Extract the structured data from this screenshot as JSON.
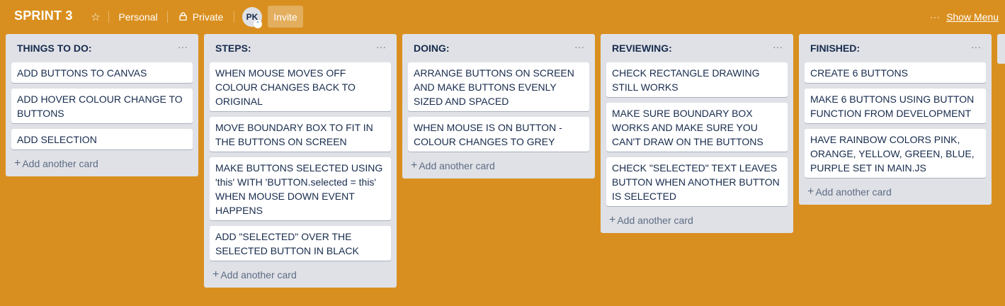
{
  "header": {
    "title": "SPRINT 3",
    "star_icon": "star-icon",
    "personal_label": "Personal",
    "private_label": "Private",
    "lock_icon": "lock-icon",
    "avatar_initials": "PK",
    "invite_label": "Invite",
    "menu_dots": "···",
    "show_menu_label": "Show Menu"
  },
  "add_card_label": "Add another card",
  "colors": {
    "board_background": "#d98f1f",
    "list_background": "#dfe1e6",
    "card_text": "#172b4d"
  },
  "lists": [
    {
      "title": "THINGS TO DO:",
      "cards": [
        "ADD BUTTONS TO CANVAS",
        "ADD HOVER COLOUR CHANGE TO BUTTONS",
        "ADD SELECTION"
      ]
    },
    {
      "title": "STEPS:",
      "cards": [
        "WHEN MOUSE MOVES OFF COLOUR CHANGES BACK TO ORIGINAL",
        "MOVE BOUNDARY BOX TO FIT IN THE BUTTONS ON SCREEN",
        "MAKE BUTTONS SELECTED USING 'this' WITH 'BUTTON.selected = this' WHEN MOUSE DOWN EVENT HAPPENS",
        "ADD \"SELECTED\" OVER THE SELECTED BUTTON IN BLACK"
      ]
    },
    {
      "title": "DOING:",
      "cards": [
        "ARRANGE BUTTONS ON SCREEN AND MAKE BUTTONS EVENLY SIZED AND SPACED",
        "WHEN MOUSE IS ON BUTTON - COLOUR CHANGES TO GREY"
      ]
    },
    {
      "title": "REVIEWING:",
      "cards": [
        "CHECK RECTANGLE DRAWING STILL WORKS",
        "MAKE SURE BOUNDARY BOX WORKS AND MAKE SURE YOU CAN'T DRAW ON THE BUTTONS",
        "CHECK \"SELECTED\" TEXT LEAVES BUTTON WHEN ANOTHER BUTTON IS SELECTED"
      ]
    },
    {
      "title": "FINISHED:",
      "cards": [
        "CREATE 6 BUTTONS",
        "MAKE 6 BUTTONS USING BUTTON FUNCTION FROM DEVELOPMENT",
        "HAVE RAINBOW COLORS PINK, ORANGE, YELLOW, GREEN, BLUE, PURPLE SET IN MAIN.JS"
      ]
    }
  ]
}
